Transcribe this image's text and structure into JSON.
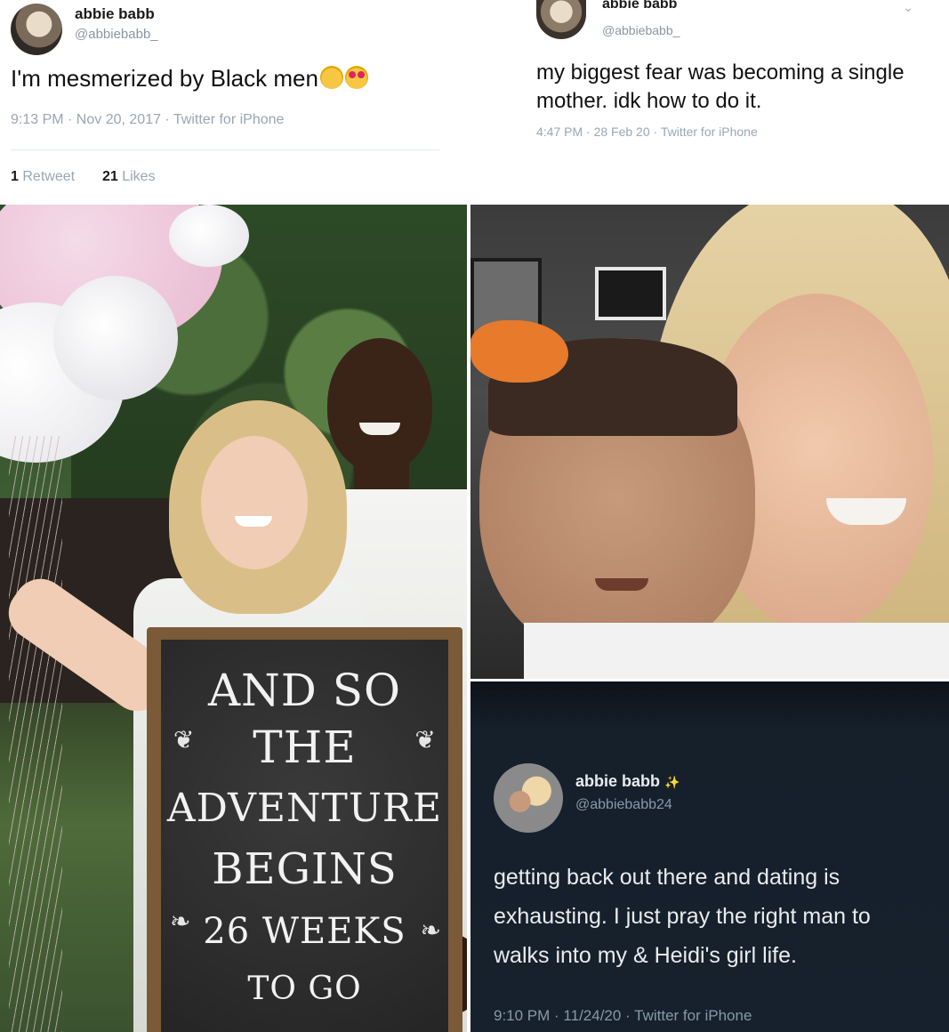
{
  "tweet_top_left": {
    "display_name": "abbie babb",
    "handle": "@abbiebabb_",
    "text": "I'm mesmerized by Black men",
    "emoji": [
      "weary-face-icon",
      "heart-eyes-icon"
    ],
    "timestamp": "9:13 PM · Nov 20, 2017 · Twitter for iPhone",
    "retweets_count": "1",
    "retweets_label": "Retweet",
    "likes_count": "21",
    "likes_label": "Likes"
  },
  "tweet_top_right": {
    "display_name": "abbie babb",
    "handle": "@abbiebabb_",
    "text": "my biggest fear was becoming a single mother. idk how to do it.",
    "timestamp": "4:47 PM · 28 Feb 20 · Twitter for iPhone"
  },
  "photo_left": {
    "chalkboard_lines": [
      "AND SO",
      "THE",
      "ADVENTURE",
      "BEGINS",
      "26 WEEKS",
      "TO GO"
    ]
  },
  "tweet_bottom_right": {
    "display_name": "abbie babb",
    "name_badge": "✨",
    "handle": "@abbiebabb24",
    "text_lines": [
      "getting back out there and dating is",
      "exhausting. I just pray the right man to",
      "walks into my & Heidi's girl life."
    ],
    "timestamp": "9:10 PM · 11/24/20 · Twitter for iPhone",
    "theme_bg": "#15202b"
  }
}
